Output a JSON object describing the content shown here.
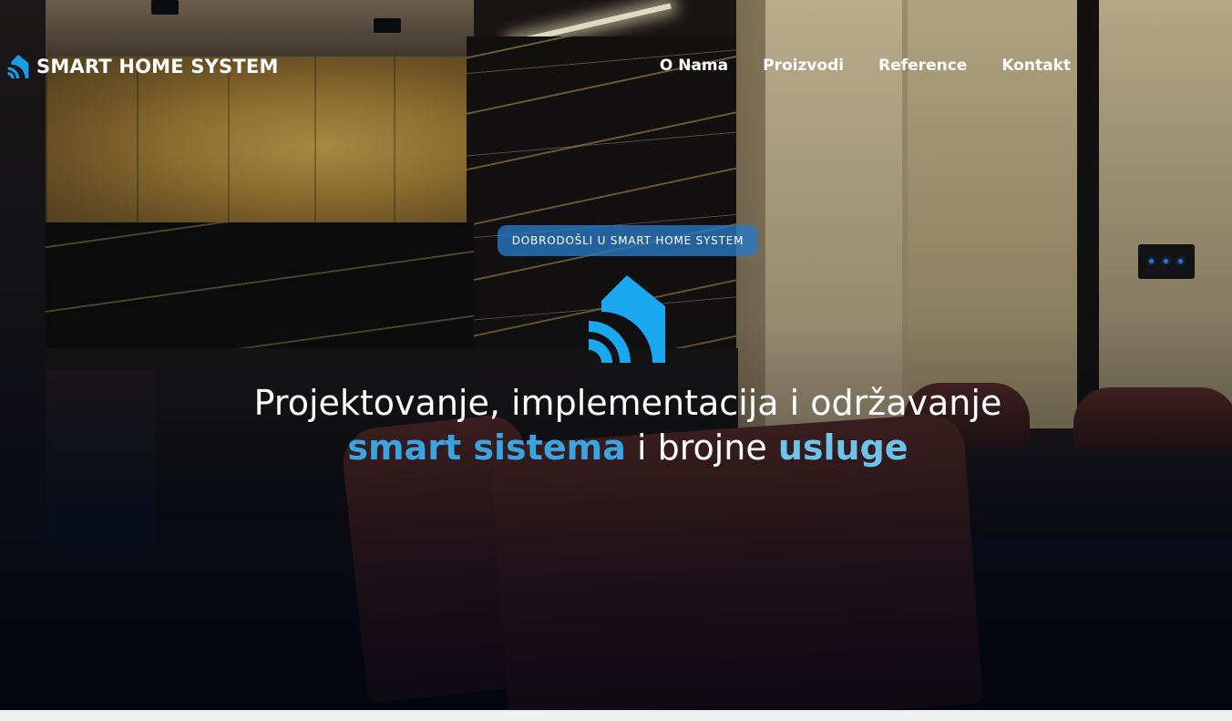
{
  "brand": {
    "name": "SMART HOME SYSTEM",
    "accent_color": "#1a9be6",
    "icon": "smart-home-wifi-icon"
  },
  "nav": {
    "items": [
      {
        "label": "O Nama"
      },
      {
        "label": "Proizvodi"
      },
      {
        "label": "Reference"
      },
      {
        "label": "Kontakt"
      }
    ]
  },
  "hero": {
    "badge": "DOBRODOŠLI U SMART HOME SYSTEM",
    "headline_line1": "Projektovanje, implementacija i održavanje",
    "headline_accent1": "smart sistema",
    "headline_mid": " i brojne ",
    "headline_accent2": "usluge",
    "icon": "smart-home-wifi-icon"
  }
}
